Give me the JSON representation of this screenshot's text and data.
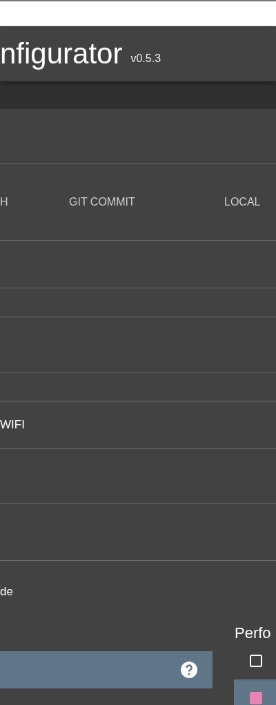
{
  "app": {
    "title": "nfigurator",
    "version": "v0.5.3"
  },
  "table": {
    "columns": [
      "H",
      "GIT COMMIT",
      "LOCAL"
    ]
  },
  "list": [
    {
      "text": "WIFI"
    },
    {
      "text": "de"
    }
  ],
  "performance": {
    "title": "Perfo",
    "options": [
      {
        "checked": false,
        "selected": false
      },
      {
        "checked": true,
        "selected": true
      }
    ]
  }
}
